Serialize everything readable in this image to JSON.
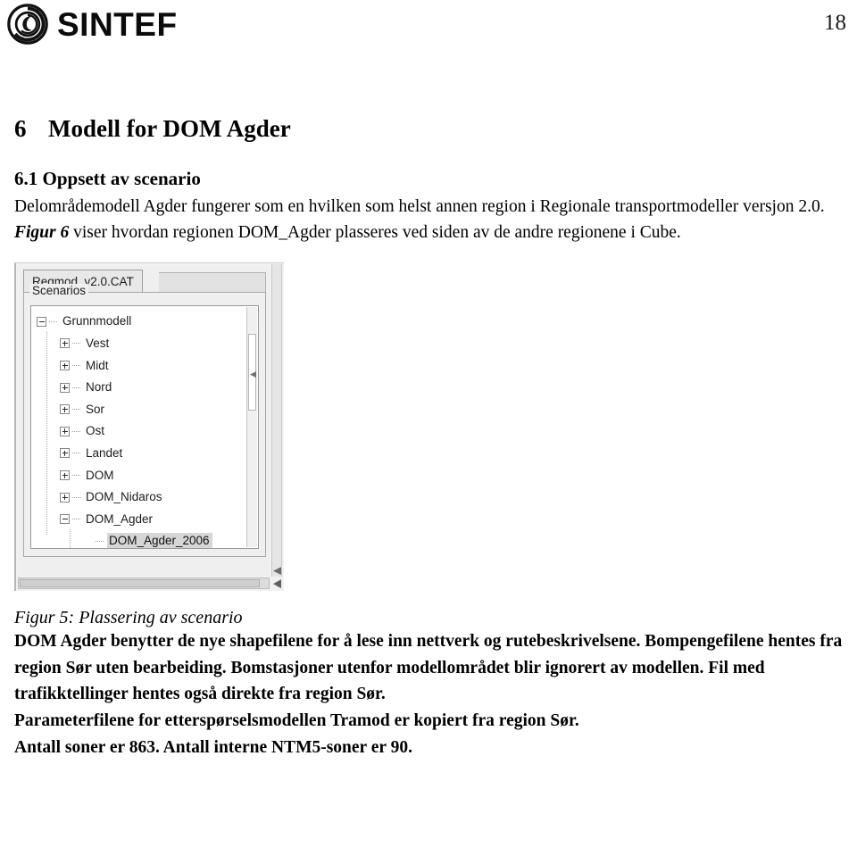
{
  "header": {
    "logo_text": "SINTEF",
    "logo_icon": "sintef-circular-logo",
    "page_number": "18"
  },
  "headings": {
    "h1_number": "6",
    "h1_title": "Modell for DOM Agder",
    "h2_title": "6.1 Oppsett av scenario"
  },
  "paragraphs": {
    "intro_part1": "Delområdemodell Agder fungerer som en hvilken som helst annen region i Regionale transportmodeller versjon 2.0. ",
    "intro_emphasis": "Figur 6",
    "intro_part2": " viser hvordan regionen DOM_Agder plasseres ved siden av de andre regionene i Cube.",
    "body_1": "DOM Agder benytter de nye shapefilene for å lese inn nettverk og rutebeskrivelsene. Bompengefilene hentes fra region Sør uten bearbeiding. Bomstasjoner utenfor modellområdet blir ignorert av modellen. Fil med trafikktellinger hentes også direkte fra region Sør.",
    "body_2": "Parameterfilene for etterspørselsmodellen Tramod er kopiert fra region Sør.",
    "body_3": "Antall soner er 863. Antall interne NTM5-soner er 90."
  },
  "figure": {
    "caption": "Figur 5: Plassering av scenario",
    "screenshot": {
      "tab_label": "Regmod_v2.0.CAT",
      "groupbox_label": "Scenarios",
      "tree": [
        {
          "label": "Grunnmodell",
          "depth": 0,
          "expander": "minus",
          "selected": false
        },
        {
          "label": "Vest",
          "depth": 1,
          "expander": "plus",
          "selected": false
        },
        {
          "label": "Midt",
          "depth": 1,
          "expander": "plus",
          "selected": false
        },
        {
          "label": "Nord",
          "depth": 1,
          "expander": "plus",
          "selected": false
        },
        {
          "label": "Sor",
          "depth": 1,
          "expander": "plus",
          "selected": false
        },
        {
          "label": "Ost",
          "depth": 1,
          "expander": "plus",
          "selected": false
        },
        {
          "label": "Landet",
          "depth": 1,
          "expander": "plus",
          "selected": false
        },
        {
          "label": "DOM",
          "depth": 1,
          "expander": "plus",
          "selected": false
        },
        {
          "label": "DOM_Nidaros",
          "depth": 1,
          "expander": "plus",
          "selected": false
        },
        {
          "label": "DOM_Agder",
          "depth": 1,
          "expander": "minus",
          "selected": false
        },
        {
          "label": "DOM_Agder_2006",
          "depth": 2,
          "expander": "none",
          "selected": true
        }
      ]
    }
  },
  "colors": {
    "selection_highlight": "#d6d6d6",
    "window_chrome": "#efefef",
    "tree_background": "#ffffff",
    "text": "#000000"
  }
}
